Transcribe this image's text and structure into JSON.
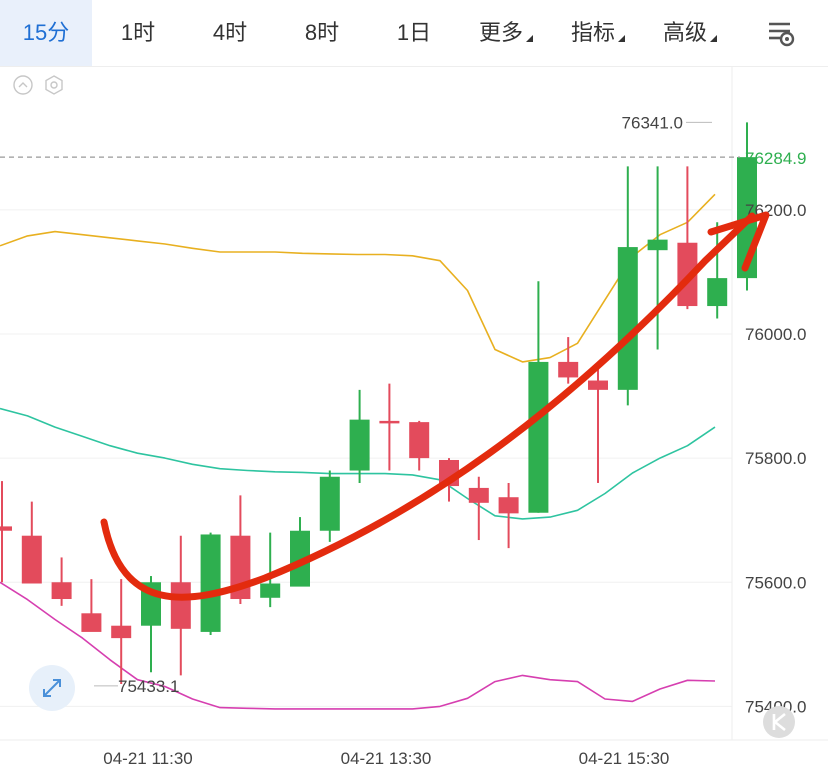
{
  "tabs": [
    {
      "label": "15分",
      "active": true
    },
    {
      "label": "1时"
    },
    {
      "label": "4时"
    },
    {
      "label": "8时"
    },
    {
      "label": "1日"
    },
    {
      "label": "更多",
      "dropdown": true
    },
    {
      "label": "指标",
      "dropdown": true
    },
    {
      "label": "高级",
      "dropdown": true
    }
  ],
  "toolbar_icons": [
    "settings-sliders-icon",
    "collapse-arrow-icon",
    "hexagon-settings-icon",
    "expand-arrows-icon",
    "k-logo-icon"
  ],
  "colors": {
    "up": "#2eaf4f",
    "down": "#e34b5c",
    "ma_upper": "#e8b020",
    "ma_mid": "#2ec4a0",
    "ma_lower": "#d63fb0",
    "arrow": "#e32b0e",
    "active_tab_bg": "#e9f0fb",
    "active_tab_text": "#1f6fd4"
  },
  "chart_data": {
    "type": "candlestick",
    "y_ticks": [
      "76200.0",
      "76000.0",
      "75800.0",
      "75600.0",
      "75400.0"
    ],
    "ylim": [
      75380,
      76380
    ],
    "x_ticks": [
      "04-21 11:30",
      "04-21 13:30",
      "04-21 15:30"
    ],
    "current_price": "76284.9",
    "max_label": "76341.0",
    "min_label": "75433.1",
    "candles": [
      {
        "o": 75690,
        "h": 75763,
        "l": 75600,
        "c": 75683
      },
      {
        "o": 75675,
        "h": 75730,
        "l": 75598,
        "c": 75598
      },
      {
        "o": 75600,
        "h": 75640,
        "l": 75562,
        "c": 75573
      },
      {
        "o": 75550,
        "h": 75605,
        "l": 75540,
        "c": 75520
      },
      {
        "o": 75530,
        "h": 75605,
        "l": 75436,
        "c": 75510
      },
      {
        "o": 75530,
        "h": 75610,
        "l": 75455,
        "c": 75600
      },
      {
        "o": 75600,
        "h": 75675,
        "l": 75450,
        "c": 75525
      },
      {
        "o": 75520,
        "h": 75680,
        "l": 75515,
        "c": 75677
      },
      {
        "o": 75675,
        "h": 75740,
        "l": 75565,
        "c": 75573
      },
      {
        "o": 75575,
        "h": 75680,
        "l": 75560,
        "c": 75598
      },
      {
        "o": 75593,
        "h": 75705,
        "l": 75595,
        "c": 75683
      },
      {
        "o": 75683,
        "h": 75780,
        "l": 75665,
        "c": 75770
      },
      {
        "o": 75780,
        "h": 75910,
        "l": 75760,
        "c": 75862
      },
      {
        "o": 75860,
        "h": 75920,
        "l": 75780,
        "c": 75858
      },
      {
        "o": 75858,
        "h": 75860,
        "l": 75780,
        "c": 75800
      },
      {
        "o": 75797,
        "h": 75800,
        "l": 75730,
        "c": 75755
      },
      {
        "o": 75752,
        "h": 75770,
        "l": 75668,
        "c": 75728
      },
      {
        "o": 75737,
        "h": 75760,
        "l": 75655,
        "c": 75711
      },
      {
        "o": 75712,
        "h": 76085,
        "l": 75712,
        "c": 75955
      },
      {
        "o": 75955,
        "h": 75995,
        "l": 75920,
        "c": 75930
      },
      {
        "o": 75925,
        "h": 75943,
        "l": 75760,
        "c": 75910
      },
      {
        "o": 75910,
        "h": 76270,
        "l": 75885,
        "c": 76140
      },
      {
        "o": 76135,
        "h": 76270,
        "l": 75975,
        "c": 76152
      },
      {
        "o": 76147,
        "h": 76270,
        "l": 76040,
        "c": 76045
      },
      {
        "o": 76045,
        "h": 76180,
        "l": 76025,
        "c": 76090
      },
      {
        "o": 76090,
        "h": 76341,
        "l": 76070,
        "c": 76284.9
      }
    ],
    "series": [
      {
        "values": [
          76142,
          76158,
          76165,
          76160,
          76155,
          76150,
          76145,
          76138,
          76132,
          76132,
          76132,
          76130,
          76129,
          76128,
          76128,
          76126,
          76118,
          76070,
          75975,
          75955,
          75962,
          75985,
          76055,
          76125,
          76160,
          76180,
          76225
        ]
      },
      {
        "values": [
          75880,
          75868,
          75850,
          75835,
          75820,
          75808,
          75800,
          75790,
          75783,
          75780,
          75778,
          75777,
          75775,
          75775,
          75775,
          75773,
          75765,
          75735,
          75707,
          75702,
          75705,
          75716,
          75743,
          75776,
          75800,
          75820,
          75850
        ]
      },
      {
        "values": [
          75600,
          75572,
          75540,
          75510,
          75475,
          75443,
          75432,
          75412,
          75398,
          75397,
          75396,
          75396,
          75396,
          75396,
          75396,
          75396,
          75400,
          75413,
          75440,
          75450,
          75443,
          75440,
          75412,
          75408,
          75428,
          75442,
          75441
        ]
      }
    ]
  }
}
